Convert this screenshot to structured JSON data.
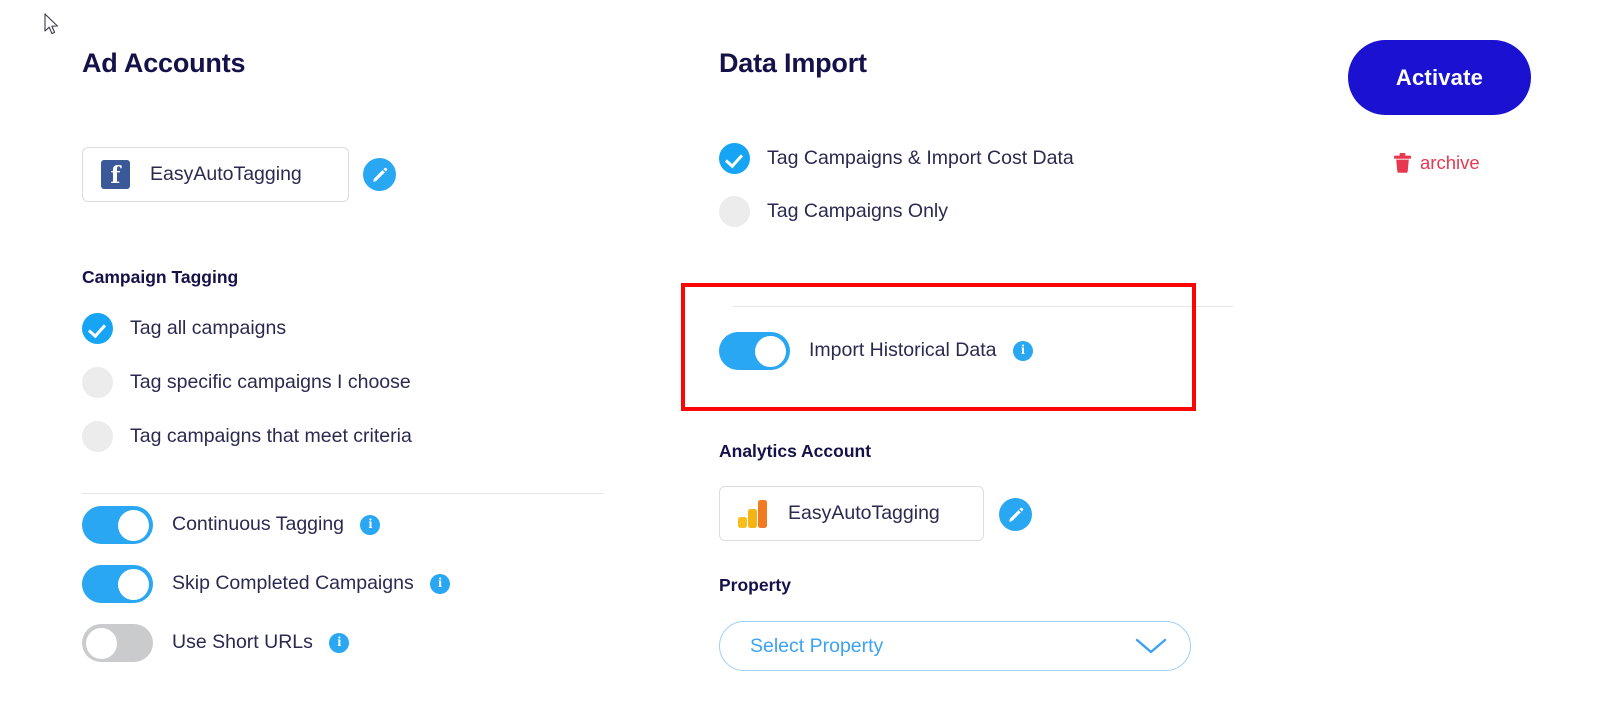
{
  "colors": {
    "heading": "#151149",
    "body_text": "#2a2a50",
    "accent_blue": "#2aa7f2",
    "activate_blue": "#1a12d0",
    "danger_red": "#e8384f",
    "annotation_red": "#fb0505",
    "toggle_off_gray": "#c9cbcd",
    "radio_off_gray": "#ececec",
    "facebook_blue": "#3b5998"
  },
  "ad_accounts": {
    "title": "Ad Accounts",
    "account": {
      "icon": "facebook-icon",
      "name": "EasyAutoTagging"
    },
    "edit_icon": "pencil-icon",
    "campaign_tagging": {
      "title": "Campaign Tagging",
      "options": [
        {
          "label": "Tag all campaigns",
          "selected": true
        },
        {
          "label": "Tag specific campaigns I choose",
          "selected": false
        },
        {
          "label": "Tag campaigns that meet criteria",
          "selected": false
        }
      ]
    },
    "toggles": [
      {
        "label": "Continuous Tagging",
        "on": true,
        "info": "info-icon"
      },
      {
        "label": "Skip Completed Campaigns",
        "on": true,
        "info": "info-icon"
      },
      {
        "label": "Use Short URLs",
        "on": false,
        "info": "info-icon"
      }
    ]
  },
  "data_import": {
    "title": "Data Import",
    "options": [
      {
        "label": "Tag Campaigns & Import Cost Data",
        "selected": true
      },
      {
        "label": "Tag Campaigns Only",
        "selected": false
      }
    ],
    "historical": {
      "label": "Import Historical Data",
      "on": true,
      "info": "info-icon",
      "highlighted": true
    },
    "analytics_account": {
      "title": "Analytics Account",
      "icon": "google-analytics-icon",
      "name": "EasyAutoTagging",
      "edit_icon": "pencil-icon"
    },
    "property": {
      "title": "Property",
      "placeholder": "Select Property",
      "value": "Select Property",
      "chevron": "chevron-down-icon"
    }
  },
  "actions": {
    "activate_label": "Activate",
    "archive_label": "archive",
    "archive_icon": "trash-icon"
  }
}
